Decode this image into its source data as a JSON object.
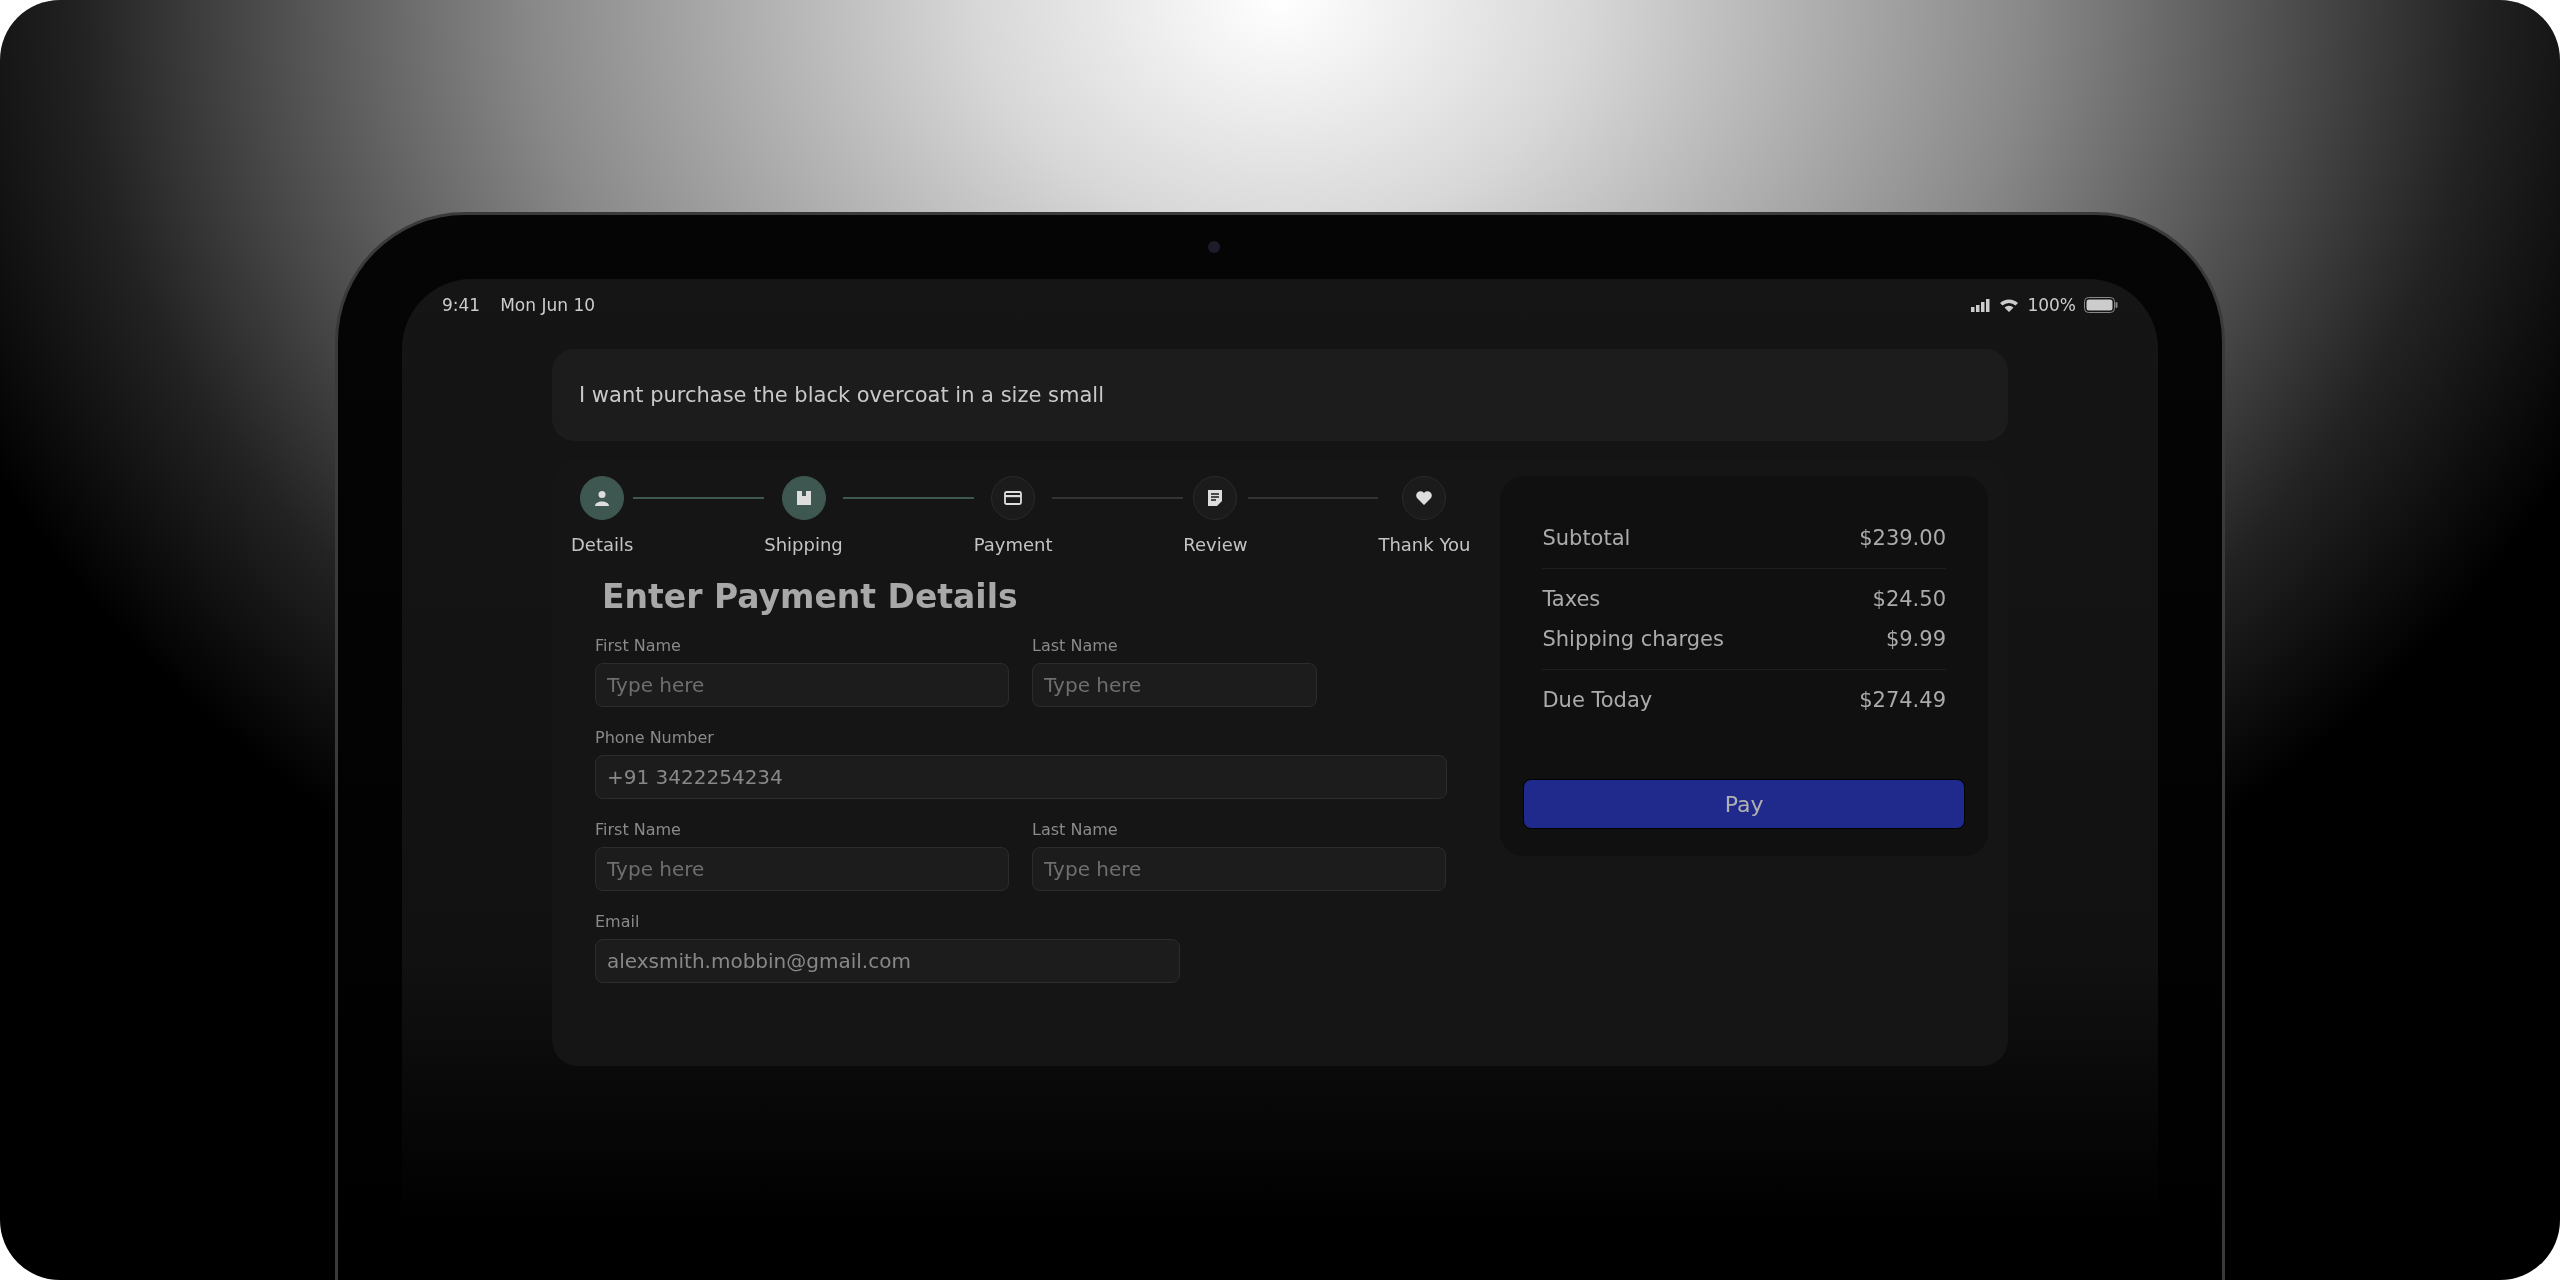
{
  "status_bar": {
    "time": "9:41",
    "date": "Mon Jun 10",
    "battery": "100%"
  },
  "prompt": {
    "text": "I want purchase the black overcoat in a size small"
  },
  "stepper": {
    "steps": [
      {
        "label": "Details",
        "completed": true
      },
      {
        "label": "Shipping",
        "completed": true
      },
      {
        "label": "Payment",
        "completed": false
      },
      {
        "label": "Review",
        "completed": false
      },
      {
        "label": "Thank You",
        "completed": false
      }
    ]
  },
  "form": {
    "title": "Enter Payment Details",
    "rows": [
      [
        {
          "label": "First Name",
          "placeholder": "Type here",
          "kind": "half"
        },
        {
          "label": "Last Name",
          "placeholder": "Type here",
          "kind": "short"
        }
      ],
      [
        {
          "label": "Phone Number",
          "value": "+91 3422254234",
          "kind": "full"
        }
      ],
      [
        {
          "label": "First Name",
          "placeholder": "Type here",
          "kind": "half"
        },
        {
          "label": "Last Name",
          "placeholder": "Type here",
          "kind": "half"
        }
      ],
      [
        {
          "label": "Email",
          "value": "alexsmith.mobbin@gmail.com",
          "kind": "wide"
        }
      ]
    ]
  },
  "summary": {
    "groups": [
      [
        {
          "label": "Subtotal",
          "amount": "$239.00"
        }
      ],
      [
        {
          "label": "Taxes",
          "amount": "$24.50"
        },
        {
          "label": "Shipping charges",
          "amount": "$9.99"
        }
      ],
      [
        {
          "label": "Due Today",
          "amount": "$274.49"
        }
      ]
    ],
    "button": "Pay"
  }
}
